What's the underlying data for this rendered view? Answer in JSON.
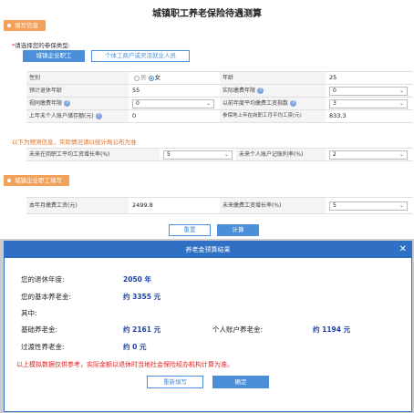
{
  "page": {
    "title": "城镇职工养老保险待遇测算"
  },
  "section1": {
    "label": "填写信息"
  },
  "type_select": {
    "label": "请选择您的参保类型:",
    "required_mark": "*",
    "options": [
      "城镇企业职工",
      "个体工商户或灵活就业人员"
    ],
    "selected": "城镇企业职工"
  },
  "form": {
    "gender_label": "性别",
    "gender_male": "男",
    "gender_female": "女",
    "gender_selected": "女",
    "age_label": "年龄",
    "age_value": "25",
    "retire_age_label": "预计退休年龄",
    "retire_age_value": "55",
    "actual_years_label": "实际缴费年限",
    "actual_years_value": "0",
    "deemed_years_label": "视同缴费年限",
    "deemed_years_value": "0",
    "avg_index_label": "以前年度平均缴费工资指数",
    "avg_index_value": "3",
    "account_balance_label": "上年末个人账户储存额(元)",
    "account_balance_value": "0",
    "avg_wage_label": "参保地上年在岗职工月平均工资(元)",
    "avg_wage_value": "833.3",
    "help_mark": "?"
  },
  "predict": {
    "notice": "以下为预测信息，实际情况请以统计局公布为准",
    "wage_growth_label": "未来在岗职工平均工资增长率(%)",
    "wage_growth_value": "5",
    "account_rate_label": "未来个人账户记账利率(%)",
    "account_rate_value": "2"
  },
  "section2": {
    "label": "城镇企业职工填写"
  },
  "enterprise": {
    "month_base_label": "本年月缴费工资(元)",
    "month_base_value": "2499.8",
    "base_growth_label": "未来缴费工资增长率(%)",
    "base_growth_value": "5"
  },
  "actions": {
    "reset": "重置",
    "calc": "计算"
  },
  "modal": {
    "title": "养老金预算结果",
    "close": "✕",
    "retire_year_label": "您的退休年度:",
    "retire_year_value": "2050 年",
    "basic_pension_label": "您的基本养老金:",
    "basic_pension_value": "约 3355 元",
    "among_label": "其中:",
    "base_pension_label": "基础养老金:",
    "base_pension_value": "约 2161 元",
    "personal_pension_label": "个人账户养老金:",
    "personal_pension_value": "约 1194 元",
    "transition_label": "过渡性养老金:",
    "transition_value": "约 0 元",
    "warning": "以上模拟数据仅供参考，实际金额以退休时当地社会保险经办机构计算为准。",
    "refill": "重新填写",
    "confirm": "确定"
  }
}
